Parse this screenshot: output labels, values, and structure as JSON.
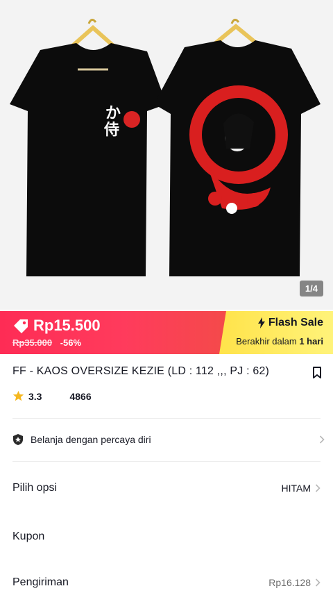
{
  "gallery": {
    "page_indicator": "1/4",
    "image_alt": "Two black oversize t-shirts on hangers"
  },
  "flash_sale": {
    "price": "Rp15.500",
    "original_price": "Rp35.000",
    "discount": "-56%",
    "label": "Flash Sale",
    "ends_prefix": "Berakhir dalam",
    "ends_value": "1 hari",
    "colors": {
      "left": "#fe2c55",
      "right": "#ffe34a"
    }
  },
  "product": {
    "title": "FF - KAOS OVERSIZE KEZIE (LD : 112 ,,, PJ : 62)",
    "rating": "3.3",
    "sold": "4866"
  },
  "trust": {
    "label": "Belanja dengan percaya diri"
  },
  "options": {
    "label": "Pilih opsi",
    "value": "HITAM"
  },
  "coupon": {
    "label": "Kupon"
  },
  "shipping": {
    "label": "Pengiriman",
    "value": "Rp16.128"
  }
}
